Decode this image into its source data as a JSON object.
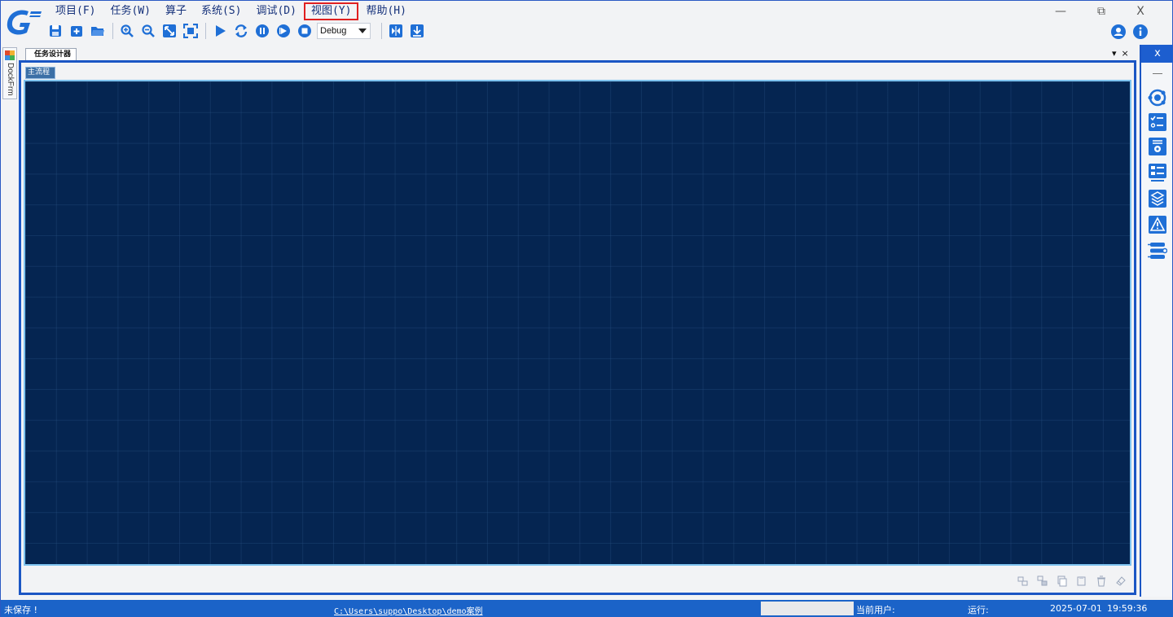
{
  "menu": {
    "items": [
      {
        "label": "项目(F)",
        "selected": false
      },
      {
        "label": "任务(W)",
        "selected": false
      },
      {
        "label": "算子",
        "selected": false
      },
      {
        "label": "系统(S)",
        "selected": false
      },
      {
        "label": "调试(D)",
        "selected": false
      },
      {
        "label": "视图(Y)",
        "selected": true
      },
      {
        "label": "帮助(H)",
        "selected": false
      }
    ]
  },
  "window_controls": {
    "minimize": "—",
    "restore": "⧉",
    "close": "X"
  },
  "toolbar": {
    "mode_select": {
      "value": "Debug"
    },
    "icons": [
      "save-icon",
      "new-icon",
      "open-folder-icon",
      "zoom-in-icon",
      "zoom-out-icon",
      "fit-icon",
      "fullscreen-icon",
      "run-icon",
      "loop-icon",
      "pause-icon",
      "step-icon",
      "stop-icon",
      "breakpoint-icon",
      "download-icon"
    ]
  },
  "top_right_icons": [
    "user-icon",
    "info-icon"
  ],
  "dock": {
    "label": "DockFrm"
  },
  "document": {
    "tab_title": "任务设计器",
    "flow_tab": "主流程",
    "controls": {
      "dropdown": "▾",
      "close": "×"
    }
  },
  "right_panel": {
    "close_label": "x",
    "icons": [
      "target-icon",
      "checklist-icon",
      "settings-list-icon",
      "list-view-icon",
      "layers-icon",
      "warning-icon",
      "flow-list-icon"
    ]
  },
  "status": {
    "save_state": "未保存 !",
    "path": "C:\\Users\\suppo\\Desktop\\demo案例",
    "current_user_label": "当前用户:",
    "run_label": "运行:",
    "date": "2025-07-01",
    "time": "19:59:36"
  },
  "colors": {
    "accent": "#1b56c4",
    "canvas": "#052551",
    "statusbar": "#1b63c8",
    "menu_text": "#14307a",
    "highlight": "#e02020"
  }
}
